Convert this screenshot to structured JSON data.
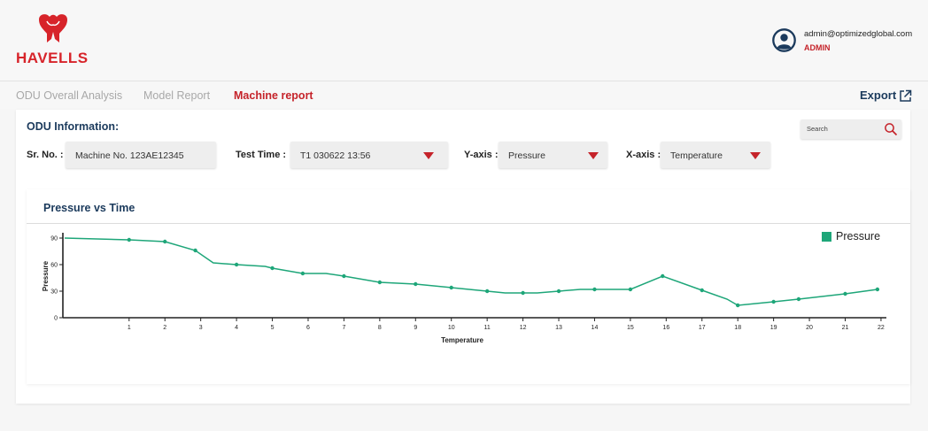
{
  "brand": {
    "name": "HAVELLS",
    "color": "#d7242a"
  },
  "user": {
    "email": "admin@optimizedglobal.com",
    "role": "ADMIN",
    "icon": "user-circle-icon"
  },
  "tabs": [
    {
      "label": "ODU Overall Analysis",
      "active": false
    },
    {
      "label": "Model Report",
      "active": false
    },
    {
      "label": "Machine report",
      "active": true
    }
  ],
  "export": {
    "label": "Export",
    "icon": "external-link-icon"
  },
  "info": {
    "title": "ODU Information:",
    "search_placeholder": "Search",
    "sr_label": "Sr. No. :",
    "sr_value": "Machine No. 123AE12345",
    "test_time_label": "Test Time :",
    "test_time_value": "T1 030622 13:56",
    "yaxis_label": "Y-axis :",
    "yaxis_value": "Pressure",
    "xaxis_label": "X-axis :",
    "xaxis_value": "Temperature"
  },
  "colors": {
    "accent": "#c5232a",
    "navy": "#1b3a5c",
    "series": "#1ea679"
  },
  "chart_data": {
    "type": "line",
    "title": "Pressure vs Time",
    "xlabel": "Temperature",
    "ylabel": "Pressure",
    "xlim": [
      -0.85,
      22.15
    ],
    "ylim": [
      0,
      90
    ],
    "xticks": [
      1,
      2,
      3,
      4,
      5,
      6,
      7,
      8,
      9,
      10,
      11,
      12,
      13,
      14,
      15,
      16,
      17,
      18,
      19,
      20,
      21,
      22
    ],
    "yticks": [
      0,
      30,
      60,
      90
    ],
    "legend": "top-right",
    "series": [
      {
        "name": "Pressure",
        "color": "#1ea679",
        "line": [
          [
            -0.8,
            90
          ],
          [
            1,
            88
          ],
          [
            2,
            86
          ],
          [
            2.85,
            76
          ],
          [
            3.35,
            62
          ],
          [
            4,
            60
          ],
          [
            4.8,
            58
          ],
          [
            5,
            56
          ],
          [
            5.85,
            50
          ],
          [
            6.5,
            50
          ],
          [
            7,
            47
          ],
          [
            8,
            40
          ],
          [
            9,
            38
          ],
          [
            10,
            34
          ],
          [
            11,
            30
          ],
          [
            11.5,
            28
          ],
          [
            12,
            28
          ],
          [
            12.4,
            28
          ],
          [
            13,
            30
          ],
          [
            13.6,
            32
          ],
          [
            14,
            32
          ],
          [
            15,
            32
          ],
          [
            15.9,
            47
          ],
          [
            17,
            31
          ],
          [
            17.7,
            21
          ],
          [
            18,
            14
          ],
          [
            19,
            18
          ],
          [
            19.7,
            21
          ],
          [
            21,
            27
          ],
          [
            21.9,
            32
          ]
        ],
        "points": [
          [
            1,
            88
          ],
          [
            2,
            86
          ],
          [
            2.85,
            76
          ],
          [
            4,
            60
          ],
          [
            5,
            56
          ],
          [
            5.85,
            50
          ],
          [
            7,
            47
          ],
          [
            8,
            40
          ],
          [
            9,
            38
          ],
          [
            10,
            34
          ],
          [
            11,
            30
          ],
          [
            12,
            28
          ],
          [
            13,
            30
          ],
          [
            14,
            32
          ],
          [
            15,
            32
          ],
          [
            15.9,
            47
          ],
          [
            17,
            31
          ],
          [
            18,
            14
          ],
          [
            19,
            18
          ],
          [
            19.7,
            21
          ],
          [
            21,
            27
          ],
          [
            21.9,
            32
          ]
        ]
      }
    ]
  }
}
